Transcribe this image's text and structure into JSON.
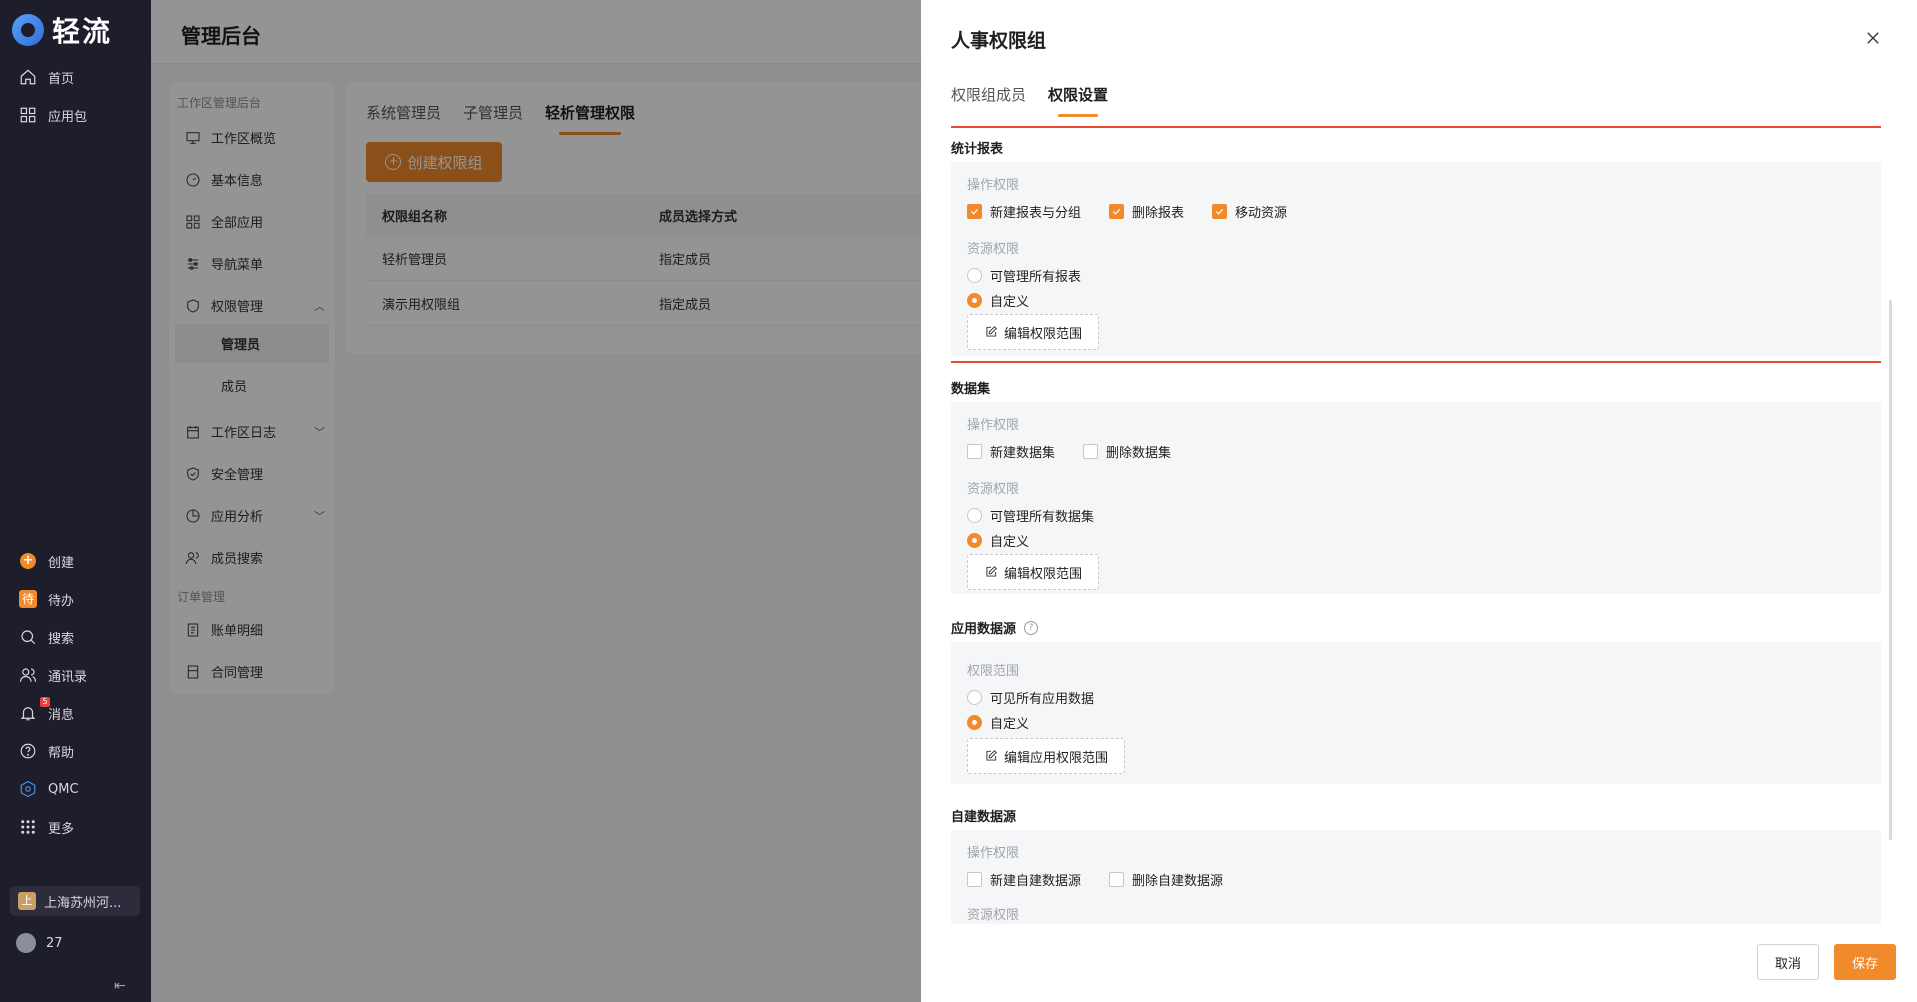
{
  "brand": {
    "name": "轻流"
  },
  "leftnav": {
    "top_items": [
      {
        "label": "首页"
      },
      {
        "label": "应用包"
      }
    ],
    "bottom_items": [
      {
        "label": "创建"
      },
      {
        "label": "待办",
        "icon_text": "待"
      },
      {
        "label": "搜索"
      },
      {
        "label": "通讯录"
      },
      {
        "label": "消息",
        "badge": "5"
      },
      {
        "label": "帮助"
      },
      {
        "label": "QMC"
      },
      {
        "label": "更多"
      }
    ],
    "workspace": {
      "label": "上海苏州河...",
      "icon_text": "上"
    },
    "user": {
      "label": "27"
    }
  },
  "main": {
    "title": "管理后台",
    "subnav": {
      "group1": "工作区管理后台",
      "items": [
        "工作区概览",
        "基本信息",
        "全部应用",
        "导航菜单",
        "权限管理"
      ],
      "sub_items": [
        "管理员",
        "成员"
      ],
      "items2": [
        "工作区日志",
        "安全管理",
        "应用分析",
        "成员搜索"
      ],
      "group2": "订单管理",
      "items3": [
        "账单明细",
        "合同管理"
      ]
    },
    "tabs": [
      "系统管理员",
      "子管理员",
      "轻析管理权限"
    ],
    "create_button": "创建权限组",
    "table": {
      "headers": [
        "权限组名称",
        "成员选择方式"
      ],
      "rows": [
        [
          "轻析管理员",
          "指定成员"
        ],
        [
          "演示用权限组",
          "指定成员"
        ]
      ]
    }
  },
  "drawer": {
    "title": "人事权限组",
    "tabs": [
      "权限组成员",
      "权限设置"
    ],
    "sections": {
      "report": {
        "title": "统计报表",
        "op_label": "操作权限",
        "ops": [
          {
            "label": "新建报表与分组",
            "checked": true
          },
          {
            "label": "删除报表",
            "checked": true
          },
          {
            "label": "移动资源",
            "checked": true
          }
        ],
        "res_label": "资源权限",
        "radios": [
          {
            "label": "可管理所有报表",
            "on": false
          },
          {
            "label": "自定义",
            "on": true
          }
        ],
        "edit_button": "编辑权限范围"
      },
      "dataset": {
        "title": "数据集",
        "op_label": "操作权限",
        "ops": [
          {
            "label": "新建数据集",
            "checked": false
          },
          {
            "label": "删除数据集",
            "checked": false
          }
        ],
        "res_label": "资源权限",
        "radios": [
          {
            "label": "可管理所有数据集",
            "on": false
          },
          {
            "label": "自定义",
            "on": true
          }
        ],
        "edit_button": "编辑权限范围"
      },
      "appsource": {
        "title": "应用数据源",
        "scope_label": "权限范围",
        "radios": [
          {
            "label": "可见所有应用数据",
            "on": false
          },
          {
            "label": "自定义",
            "on": true
          }
        ],
        "edit_button": "编辑应用权限范围"
      },
      "selfsource": {
        "title": "自建数据源",
        "op_label": "操作权限",
        "ops": [
          {
            "label": "新建自建数据源",
            "checked": false
          },
          {
            "label": "删除自建数据源",
            "checked": false
          }
        ],
        "res_label": "资源权限"
      }
    },
    "footer": {
      "cancel": "取消",
      "save": "保存"
    }
  },
  "colors": {
    "accent": "#f08a2b",
    "highlight": "#e84a2f",
    "nav_bg": "#1d1d2b"
  }
}
